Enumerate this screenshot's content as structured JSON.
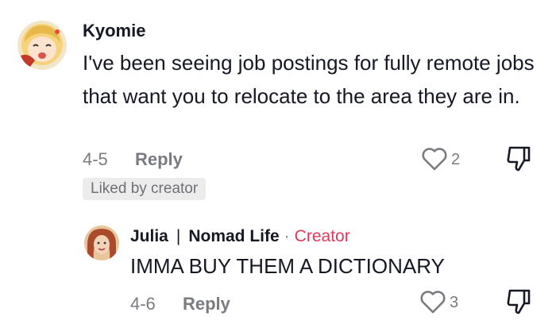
{
  "comment": {
    "author": "Kyomie",
    "text": "I've been seeing job postings for fully remote jobs that want you to relocate to the area they are in.",
    "date": "4-5",
    "reply_label": "Reply",
    "like_count": "2",
    "liked_by_creator": "Liked by creator",
    "like_icon": "heart-outline-icon",
    "dislike_icon": "thumbs-down-icon"
  },
  "reply": {
    "author": "Julia",
    "separator": "|",
    "channel": "Nomad Life",
    "dot": "·",
    "role": "Creator",
    "text": "IMMA BUY THEM A DICTIONARY",
    "date": "4-6",
    "reply_label": "Reply",
    "like_count": "3",
    "like_icon": "heart-outline-icon",
    "dislike_icon": "thumbs-down-icon"
  },
  "colors": {
    "text": "#161823",
    "muted": "#7a7b80",
    "creator": "#e6375a",
    "badge_bg": "#ececed"
  }
}
